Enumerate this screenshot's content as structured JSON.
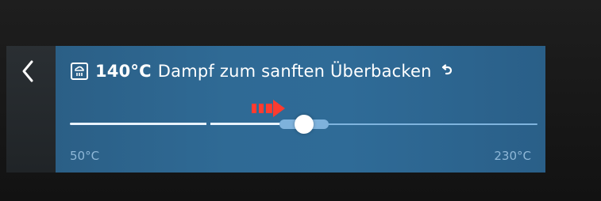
{
  "colors": {
    "panel": "#2f6a95",
    "text": "#ffffff",
    "scale_text": "#8fb8d8",
    "hint_arrow": "#ff3b2f",
    "track_active": "#e9f3ff",
    "track_inactive": "#7fb4de"
  },
  "header": {
    "mode_icon": "steam-oven-icon",
    "temperature": "140°C",
    "description": "Dampf zum sanften Überbacken",
    "undo_icon": "undo-icon"
  },
  "nav": {
    "back_icon": "chevron-left-icon"
  },
  "slider": {
    "min_label": "50°C",
    "max_label": "230°C",
    "min": 50,
    "max": 230,
    "value": 140,
    "hint_icon": "arrow-right-hint-icon"
  }
}
